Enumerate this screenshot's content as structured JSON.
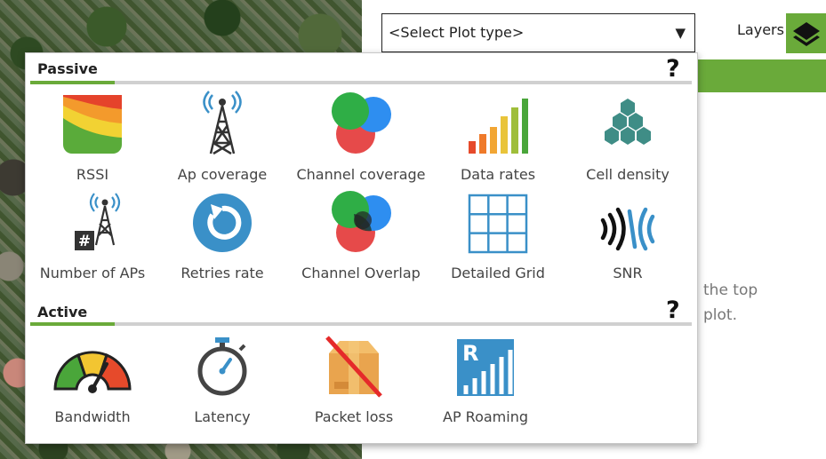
{
  "plot_select": {
    "value": "<Select Plot type>",
    "arrow_icon": "caret-down-icon"
  },
  "layers": {
    "label": "Layers",
    "icon": "layers-icon"
  },
  "hint": {
    "line1": "the top",
    "line2": "plot."
  },
  "passive": {
    "title": "Passive",
    "help": "?",
    "items": [
      {
        "label": "RSSI",
        "icon": "rssi-heatmap-icon"
      },
      {
        "label": "Ap coverage",
        "icon": "ap-tower-icon"
      },
      {
        "label": "Channel coverage",
        "icon": "channel-circles-icon"
      },
      {
        "label": "Data rates",
        "icon": "bar-rates-icon"
      },
      {
        "label": "Cell density",
        "icon": "hexagon-cluster-icon"
      },
      {
        "label": "Number of APs",
        "icon": "ap-count-icon"
      },
      {
        "label": "Retries rate",
        "icon": "retry-arrow-icon"
      },
      {
        "label": "Channel Overlap",
        "icon": "channel-overlap-icon"
      },
      {
        "label": "Detailed Grid",
        "icon": "grid-icon"
      },
      {
        "label": "SNR",
        "icon": "snr-waves-icon"
      }
    ]
  },
  "active": {
    "title": "Active",
    "help": "?",
    "items": [
      {
        "label": "Bandwidth",
        "icon": "gauge-icon"
      },
      {
        "label": "Latency",
        "icon": "stopwatch-icon"
      },
      {
        "label": "Packet loss",
        "icon": "crossed-package-icon"
      },
      {
        "label": "AP Roaming",
        "icon": "ap-roaming-icon",
        "letter": "R"
      }
    ]
  },
  "colors": {
    "accent": "#6aaa3a",
    "icon_blue": "#3a90c8",
    "icon_teal": "#3f8d86"
  }
}
